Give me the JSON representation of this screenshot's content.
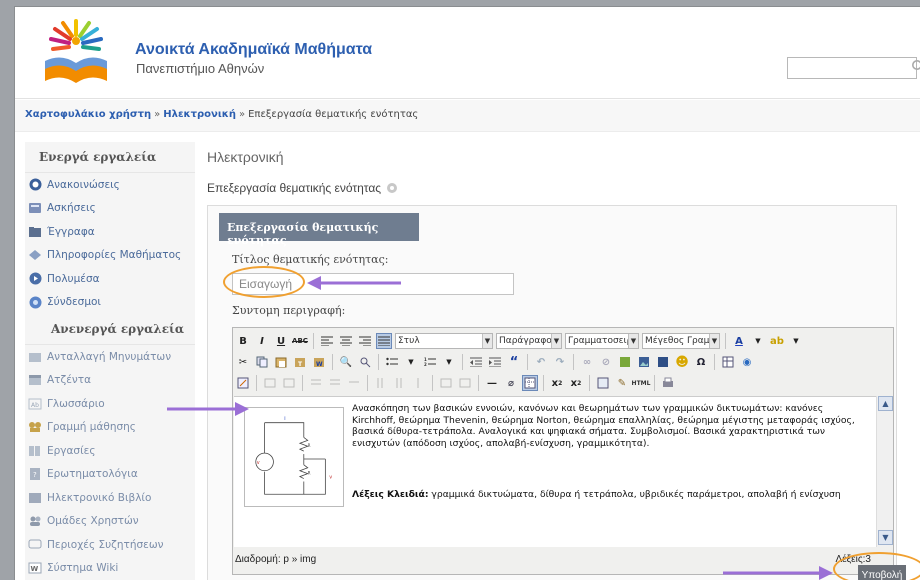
{
  "header": {
    "site_title": "Ανοικτά Ακαδημαϊκά Μαθήματα",
    "site_subtitle": "Πανεπιστήμιο Αθηνών",
    "search": {
      "value": "",
      "placeholder": ""
    }
  },
  "breadcrumb": {
    "items": [
      "Χαρτοφυλάκιο χρήστη",
      "Ηλεκτρονική",
      "Επεξεργασία θεματικής ενότητας"
    ],
    "separator": "»"
  },
  "sidebar": {
    "active_heading": "Ενεργά εργαλεία",
    "active_items": [
      {
        "label": "Ανακοινώσεις",
        "icon": "announcements-icon"
      },
      {
        "label": "Ασκήσεις",
        "icon": "exercises-icon"
      },
      {
        "label": "Έγγραφα",
        "icon": "documents-icon"
      },
      {
        "label": "Πληροφορίες Μαθήματος",
        "icon": "info-icon"
      },
      {
        "label": "Πολυμέσα",
        "icon": "multimedia-icon"
      },
      {
        "label": "Σύνδεσμοι",
        "icon": "links-icon"
      }
    ],
    "inactive_heading": "Ανενεργά εργαλεία",
    "inactive_items": [
      {
        "label": "Ανταλλαγή Μηνυμάτων",
        "icon": "messages-icon"
      },
      {
        "label": "Ατζέντα",
        "icon": "agenda-icon"
      },
      {
        "label": "Γλωσσάριο",
        "icon": "glossary-icon"
      },
      {
        "label": "Γραμμή μάθησης",
        "icon": "learning-path-icon"
      },
      {
        "label": "Εργασίες",
        "icon": "assignments-icon"
      },
      {
        "label": "Ερωτηματολόγια",
        "icon": "questionnaire-icon"
      },
      {
        "label": "Ηλεκτρονικό Βιβλίο",
        "icon": "ebook-icon"
      },
      {
        "label": "Ομάδες Χρηστών",
        "icon": "user-groups-icon"
      },
      {
        "label": "Περιοχές Συζητήσεων",
        "icon": "forum-icon"
      },
      {
        "label": "Σύστημα Wiki",
        "icon": "wiki-icon"
      }
    ]
  },
  "main": {
    "course_name": "Ηλεκτρονική",
    "page_subtitle": "Επεξεργασία θεματικής ενότητας",
    "panel_title": "Επεξεργασία θεματικής ενότητας",
    "title_label": "Τίτλος θεματικής ενότητας:",
    "title_value": "Εισαγωγή",
    "desc_label": "Συντομη περιγραφή:",
    "editor": {
      "style_select": "Στυλ",
      "paragraph_select": "Παράγραφος",
      "font_select": "Γραμματοσειρ",
      "size_select": "Μέγεθος Γραμ",
      "description": "Ανασκόπηση των βασικών εννοιών, κανόνων και θεωρημάτων των γραμμικών δικτυωμάτων: κανόνες Kirchhoff, θεώρημα Thevenin, θεώρημα Norton, θεώρημα επαλληλίας, θεώρημα μέγιστης μεταφοράς ισχύος, βασικά δίθυρα-τετράπολα. Αναλογικά και ψηφιακά σήματα. Συμβολισμοί. Βασικά χαρακτηριστικά των ενισχυτών (απόδοση ισχύος, απολαβή-ενίσχυση, γραμμικότητα).",
      "keywords_label": "Λέξεις Κλειδιά:",
      "keywords": "γραμμικά δικτυώματα, δίθυρα ή τετράπολα, υβριδικές παράμετροι, απολαβή ή ενίσχυση",
      "path": "Διαδρομή: p » img",
      "word_count": "Λέξεις:3"
    },
    "submit_label": "Υποβολή"
  },
  "colors": {
    "brand_blue": "#2d5fb0",
    "panel_header": "#6f7d90",
    "annotation_orange": "#f0a030",
    "annotation_purple": "#9b6fd6"
  }
}
